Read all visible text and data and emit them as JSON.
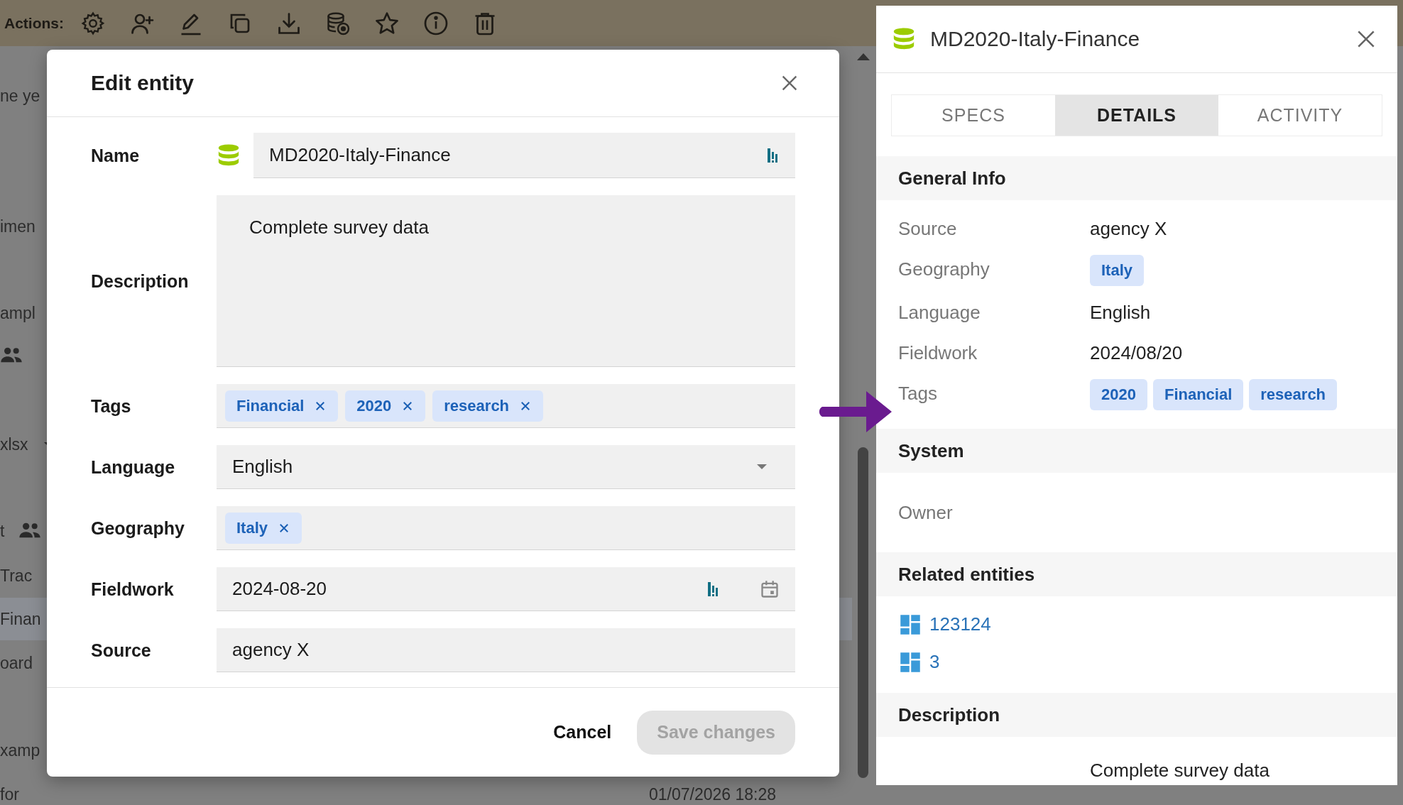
{
  "toolbar": {
    "label": "Actions:"
  },
  "background_rows": [
    {
      "text": "ne ye",
      "selected": false
    },
    {
      "text": "imen",
      "selected": false
    },
    {
      "text": "ampl",
      "selected": false
    },
    {
      "kind": "people",
      "selected": false
    },
    {
      "text": "xlsx",
      "kind": "dropdown",
      "selected": false
    },
    {
      "text": "t",
      "kind": "people",
      "selected": false
    },
    {
      "text": "Trac",
      "selected": false
    },
    {
      "text": "Finan",
      "selected": true
    },
    {
      "text": "oard",
      "selected": false
    },
    {
      "text": "xamp",
      "selected": false
    },
    {
      "text": "for",
      "date": "01/07/2026 18:28",
      "selected": false
    }
  ],
  "edit_dialog": {
    "title": "Edit entity",
    "fields": [
      {
        "label": "Name",
        "kind": "name",
        "value": "MD2020-Italy-Finance"
      },
      {
        "label": "Description",
        "kind": "textarea",
        "value": "Complete survey data"
      },
      {
        "label": "Tags",
        "kind": "chips",
        "chips": [
          "Financial",
          "2020",
          "research"
        ]
      },
      {
        "label": "Language",
        "kind": "select",
        "value": "English"
      },
      {
        "label": "Geography",
        "kind": "chips",
        "chips": [
          "Italy"
        ]
      },
      {
        "label": "Fieldwork",
        "kind": "date",
        "value": "2024-08-20"
      },
      {
        "label": "Source",
        "kind": "text",
        "value": "agency X"
      }
    ],
    "buttons": [
      {
        "label": "Cancel",
        "kind": "text",
        "disabled": false
      },
      {
        "label": "Save changes",
        "kind": "primary",
        "disabled": true
      }
    ]
  },
  "details_panel": {
    "title": "MD2020-Italy-Finance",
    "tabs": [
      {
        "label": "SPECS",
        "selected": false
      },
      {
        "label": "DETAILS",
        "selected": true
      },
      {
        "label": "ACTIVITY",
        "selected": false
      }
    ],
    "sections": [
      {
        "title": "General Info",
        "kind": "fields",
        "fields": [
          {
            "label": "Source",
            "value": "agency X"
          },
          {
            "label": "Geography",
            "chips": [
              "Italy"
            ]
          },
          {
            "label": "Language",
            "value": "English"
          },
          {
            "label": "Fieldwork",
            "value": "2024/08/20"
          },
          {
            "label": "Tags",
            "chips": [
              "2020",
              "Financial",
              "research"
            ]
          }
        ]
      },
      {
        "title": "System",
        "kind": "fields",
        "fields": [
          {
            "label": "Owner"
          }
        ]
      },
      {
        "title": "Related entities",
        "kind": "links",
        "links": [
          "123124",
          "3"
        ]
      },
      {
        "title": "Description",
        "kind": "text",
        "text": "Complete survey data"
      }
    ]
  }
}
